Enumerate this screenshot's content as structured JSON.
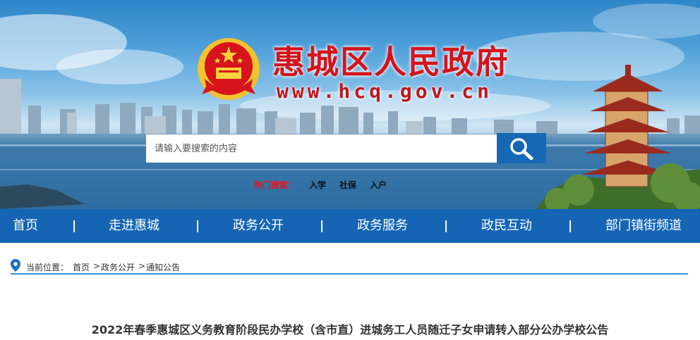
{
  "header": {
    "site_title": "惠城区人民政府",
    "site_url": "www.hcq.gov.cn"
  },
  "search": {
    "placeholder": "请输入要搜索的内容",
    "hot_label": "热门搜索：",
    "hot_items": [
      "入学",
      "社保",
      "入户"
    ]
  },
  "nav": {
    "items": [
      "首页",
      "走进惠城",
      "政务公开",
      "政务服务",
      "政民互动",
      "部门镇街频道"
    ],
    "separator": "|"
  },
  "breadcrumb": {
    "label": "当前位置：",
    "items": [
      "首页",
      "政务公开",
      "通知公告"
    ],
    "separator": ">"
  },
  "article": {
    "title": "2022年春季惠城区义务教育阶段民办学校（含市直）进城务工人员随迁子女申请转入部分公办学校公告"
  },
  "colors": {
    "nav_bg": "#1565b4",
    "title_red": "#d3141c",
    "hot_label_red": "#e3181f",
    "breadcrumb_line": "#3e8ee0"
  }
}
